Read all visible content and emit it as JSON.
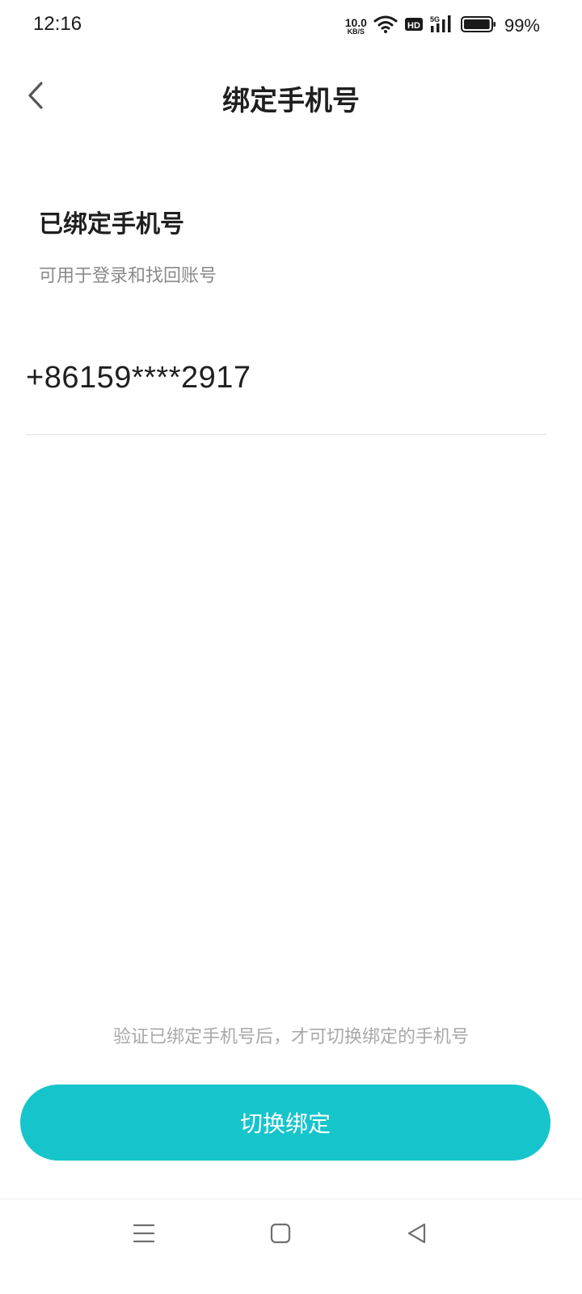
{
  "status_bar": {
    "time": "12:16",
    "net_speed_value": "10.0",
    "net_speed_unit": "KB/S",
    "hd_label": "HD",
    "network_label": "5G",
    "battery_percent": "99%",
    "battery_level": 0.99
  },
  "header": {
    "title": "绑定手机号",
    "back_icon": "chevron-left-icon"
  },
  "bound_section": {
    "title": "已绑定手机号",
    "subtitle": "可用于登录和找回账号",
    "phone_number": "+86159****2917"
  },
  "footer": {
    "hint": "验证已绑定手机号后，才可切换绑定的手机号",
    "switch_button_label": "切换绑定"
  },
  "nav_bar": {
    "icons": [
      "menu-icon",
      "home-icon",
      "back-triangle-icon"
    ]
  },
  "colors": {
    "accent": "#15c5cb",
    "text_primary": "#1f1f1f",
    "text_secondary": "#8a8a8a",
    "hint": "#a8a8a8",
    "divider": "#e4e4e4"
  }
}
